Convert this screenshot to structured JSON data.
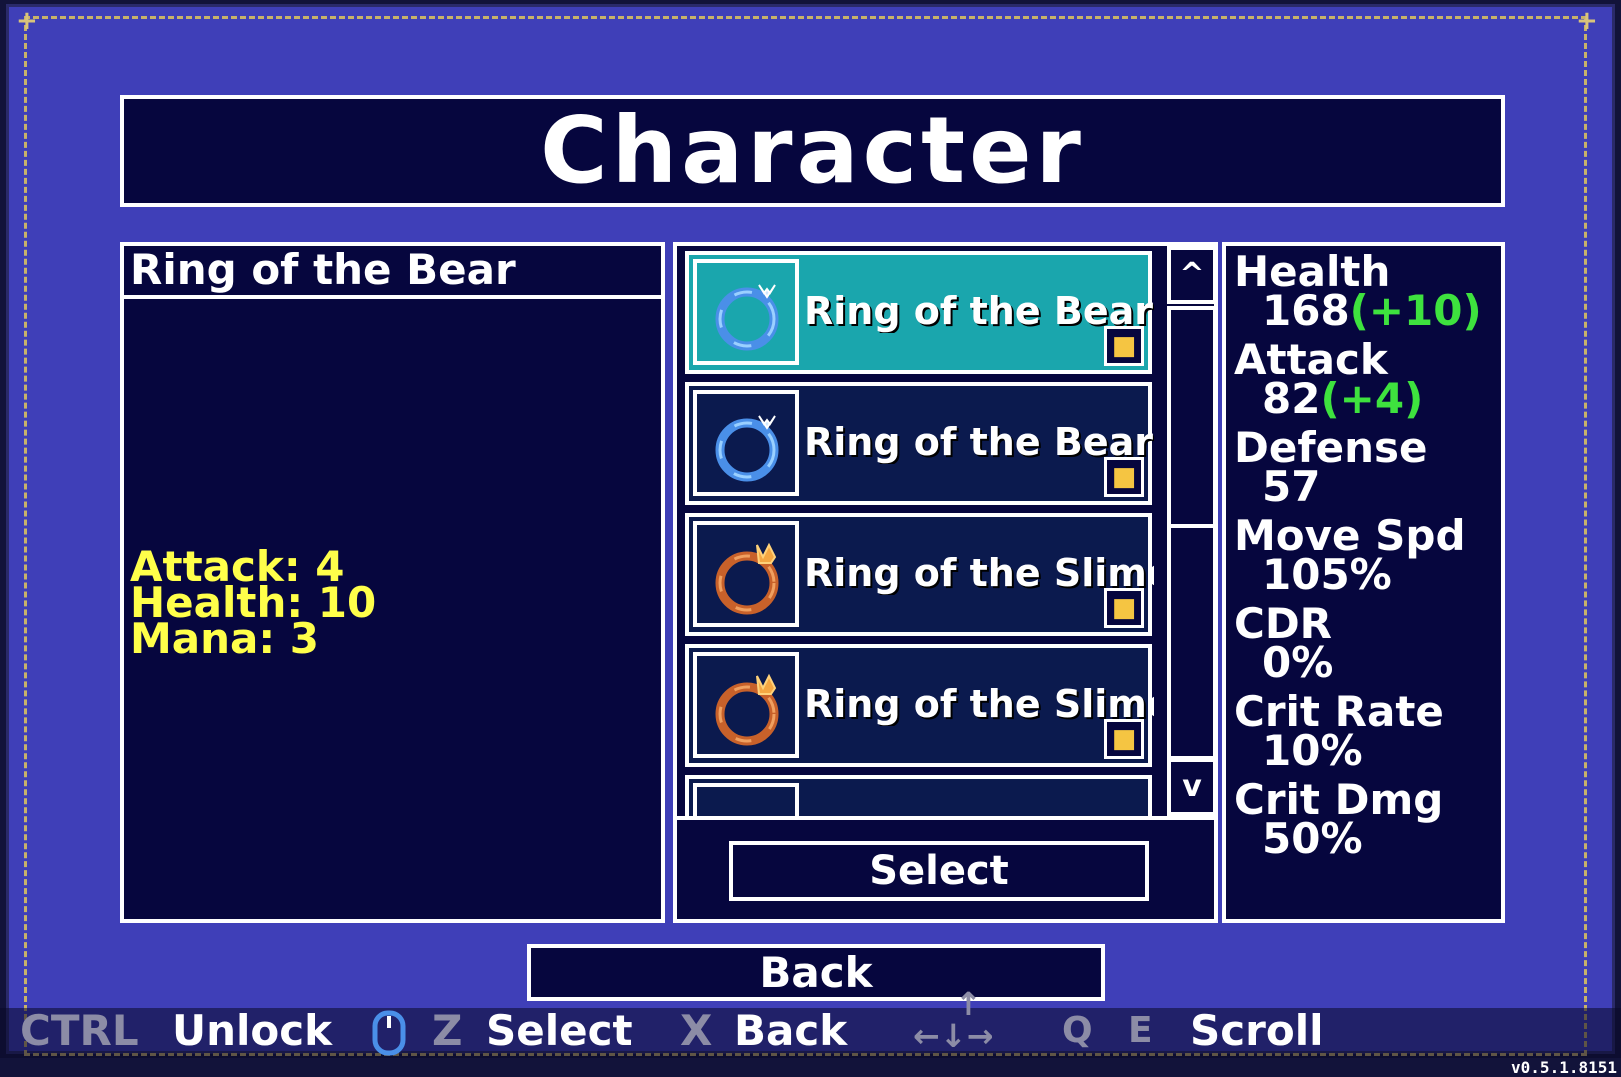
{
  "screen": {
    "title": "Character"
  },
  "detail": {
    "title": "Ring of the Bear",
    "stats": [
      "Attack: 4",
      "Health: 10",
      "Mana: 3"
    ]
  },
  "inventory": {
    "items": [
      {
        "name": "Ring of the Bear",
        "icon": "blue-ring-icon",
        "locked": true,
        "selected": true
      },
      {
        "name": "Ring of the Bear",
        "icon": "blue-ring-icon",
        "locked": true,
        "selected": false
      },
      {
        "name": "Ring of the Slime King",
        "icon": "orange-ring-icon",
        "locked": true,
        "selected": false
      },
      {
        "name": "Ring of the Slime King",
        "icon": "orange-ring-icon",
        "locked": true,
        "selected": false
      }
    ],
    "scroll_up": "^",
    "scroll_down": "v",
    "select_label": "Select"
  },
  "character_stats": [
    {
      "label": "Health",
      "value": "168",
      "bonus": "(+10)"
    },
    {
      "label": "Attack",
      "value": "82",
      "bonus": "(+4)"
    },
    {
      "label": "Defense",
      "value": "57",
      "bonus": ""
    },
    {
      "label": "Move Spd",
      "value": "105%",
      "bonus": ""
    },
    {
      "label": "CDR",
      "value": "0%",
      "bonus": ""
    },
    {
      "label": "Crit Rate",
      "value": "10%",
      "bonus": ""
    },
    {
      "label": "Crit Dmg",
      "value": "50%",
      "bonus": ""
    }
  ],
  "back_label": "Back",
  "hints": {
    "unlock_key": "CTRL",
    "unlock": "Unlock",
    "select_key": "Z",
    "select": "Select",
    "back_key": "X",
    "back": "Back",
    "scroll_key_q": "Q",
    "scroll_key_e": "E",
    "scroll": "Scroll"
  },
  "version": "v0.5.1.8151",
  "colors": {
    "frame": "#3f3fb8",
    "panel": "#06063e",
    "selected": "#1aa6ad",
    "stat_text": "#ffff4a",
    "bonus": "#3ee23e"
  }
}
